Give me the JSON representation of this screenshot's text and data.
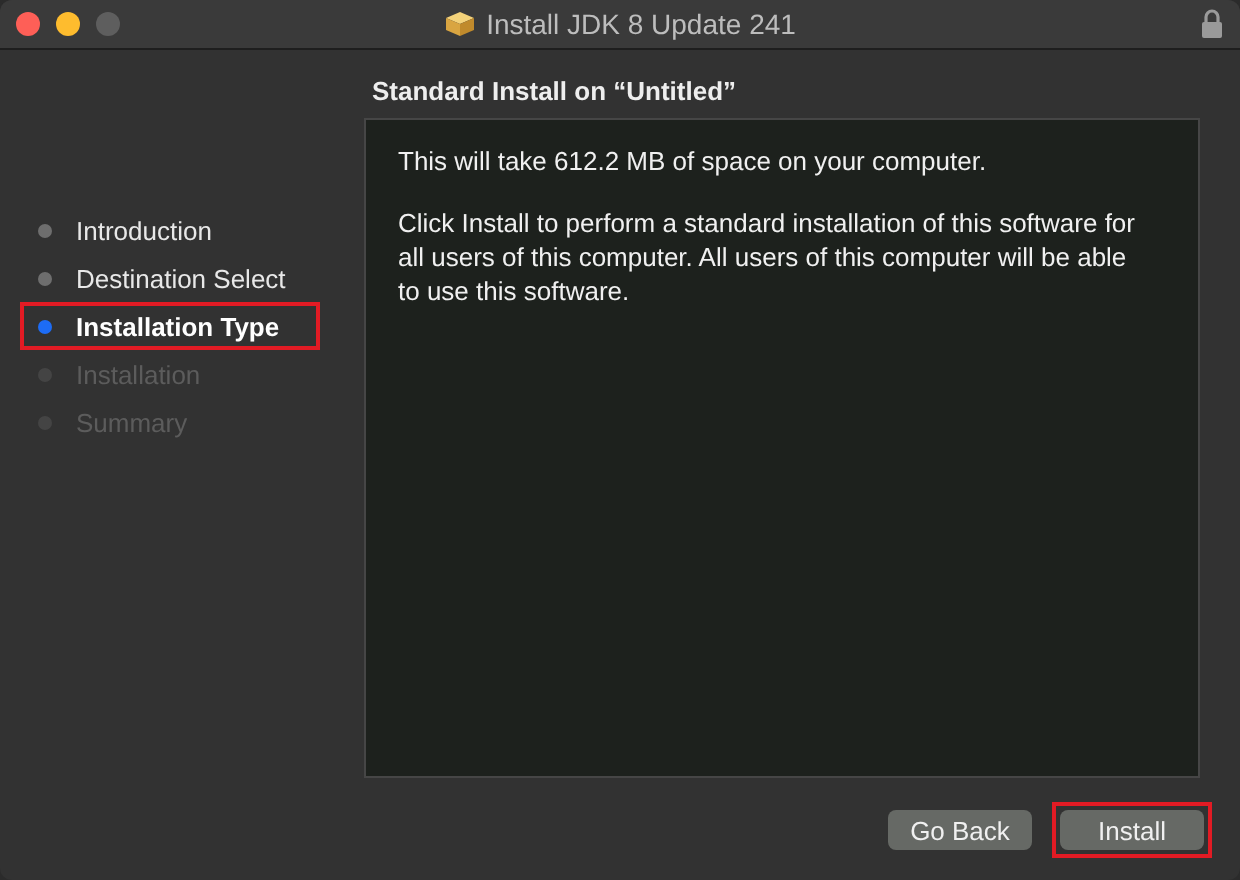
{
  "window": {
    "title": "Install JDK 8 Update 241",
    "locked": true
  },
  "heading": "Standard Install on “Untitled”",
  "steps": [
    {
      "label": "Introduction",
      "selected": false,
      "disabled": false,
      "highlighted": false
    },
    {
      "label": "Destination Select",
      "selected": false,
      "disabled": false,
      "highlighted": false
    },
    {
      "label": "Installation Type",
      "selected": true,
      "disabled": false,
      "highlighted": true
    },
    {
      "label": "Installation",
      "selected": false,
      "disabled": true,
      "highlighted": false
    },
    {
      "label": "Summary",
      "selected": false,
      "disabled": true,
      "highlighted": false
    }
  ],
  "paragraphs": [
    "This will take 612.2 MB of space on your computer.",
    "Click Install to perform a standard installation of this software for all users of this computer. All users of this computer will be able to use this software."
  ],
  "buttons": [
    {
      "label": "Go Back",
      "highlighted": false
    },
    {
      "label": "Install",
      "highlighted": true
    }
  ]
}
